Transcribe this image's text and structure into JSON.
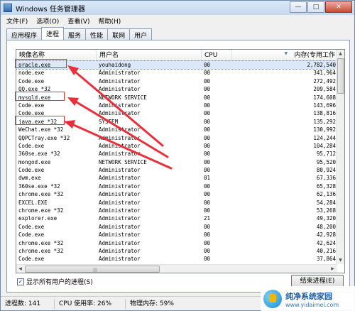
{
  "window": {
    "title": "Windows 任务管理器",
    "controls": [
      "—",
      "□",
      "✕"
    ]
  },
  "menu": [
    "文件(F)",
    "选项(O)",
    "查看(V)",
    "帮助(H)"
  ],
  "tabs": [
    {
      "label": "应用程序",
      "active": false
    },
    {
      "label": "进程",
      "active": true
    },
    {
      "label": "服务",
      "active": false
    },
    {
      "label": "性能",
      "active": false
    },
    {
      "label": "联网",
      "active": false
    },
    {
      "label": "用户",
      "active": false
    }
  ],
  "columns": [
    "映像名称",
    "用户名",
    "CPU",
    "内存(专用工作"
  ],
  "rows": [
    {
      "name": "oracle.exe",
      "user": "youhaidong",
      "cpu": "00",
      "mem": "2,782,540",
      "selected": true
    },
    {
      "name": "node.exe",
      "user": "Administrator",
      "cpu": "00",
      "mem": "341,964"
    },
    {
      "name": "Code.exe",
      "user": "Administrator",
      "cpu": "00",
      "mem": "272,492"
    },
    {
      "name": "QQ.exe *32",
      "user": "Administrator",
      "cpu": "00",
      "mem": "209,584"
    },
    {
      "name": "mysqld.exe",
      "user": "NETWORK SERVICE",
      "cpu": "00",
      "mem": "174,608"
    },
    {
      "name": "Code.exe",
      "user": "Administrator",
      "cpu": "00",
      "mem": "143,696"
    },
    {
      "name": "Code.exe",
      "user": "Administrator",
      "cpu": "00",
      "mem": "138,816"
    },
    {
      "name": "java.exe *32",
      "user": "SYSTEM",
      "cpu": "00",
      "mem": "135,292"
    },
    {
      "name": "WeChat.exe *32",
      "user": "Administrator",
      "cpu": "00",
      "mem": "130,992"
    },
    {
      "name": "QQPCTray.exe *32",
      "user": "Administrator",
      "cpu": "00",
      "mem": "124,244"
    },
    {
      "name": "Code.exe",
      "user": "Administrator",
      "cpu": "00",
      "mem": "104,284"
    },
    {
      "name": "360se.exe *32",
      "user": "Administrator",
      "cpu": "00",
      "mem": "95,712"
    },
    {
      "name": "mongod.exe",
      "user": "NETWORK SERVICE",
      "cpu": "00",
      "mem": "95,520"
    },
    {
      "name": "Code.exe",
      "user": "Administrator",
      "cpu": "00",
      "mem": "80,924"
    },
    {
      "name": "dwm.exe",
      "user": "Administrator",
      "cpu": "01",
      "mem": "67,336"
    },
    {
      "name": "360se.exe *32",
      "user": "Administrator",
      "cpu": "00",
      "mem": "65,328"
    },
    {
      "name": "chrome.exe *32",
      "user": "Administrator",
      "cpu": "00",
      "mem": "62,136"
    },
    {
      "name": "EXCEL.EXE",
      "user": "Administrator",
      "cpu": "00",
      "mem": "54,284"
    },
    {
      "name": "chrome.exe *32",
      "user": "Administrator",
      "cpu": "00",
      "mem": "53,268"
    },
    {
      "name": "explorer.exe",
      "user": "Administrator",
      "cpu": "21",
      "mem": "49,320"
    },
    {
      "name": "Code.exe",
      "user": "Administrator",
      "cpu": "00",
      "mem": "48,200"
    },
    {
      "name": "Code.exe",
      "user": "Administrator",
      "cpu": "00",
      "mem": "42,928"
    },
    {
      "name": "chrome.exe *32",
      "user": "Administrator",
      "cpu": "00",
      "mem": "42,624"
    },
    {
      "name": "chrome.exe *32",
      "user": "Administrator",
      "cpu": "00",
      "mem": "40,216"
    },
    {
      "name": "Code.exe",
      "user": "Administrator",
      "cpu": "00",
      "mem": "37,864"
    }
  ],
  "show_all_label": "显示所有用户的进程(S)",
  "show_all_checked": "✓",
  "end_process_label": "结束进程(E)",
  "status": {
    "processes": "进程数: 141",
    "cpu": "CPU 使用率: 26%",
    "memory": "物理内存: 59%"
  },
  "watermark": {
    "title": "纯净系统家园",
    "url": "www.yidaimei.com"
  },
  "annotation_color": "#e8303a",
  "selection_color": "#dbe8f8"
}
